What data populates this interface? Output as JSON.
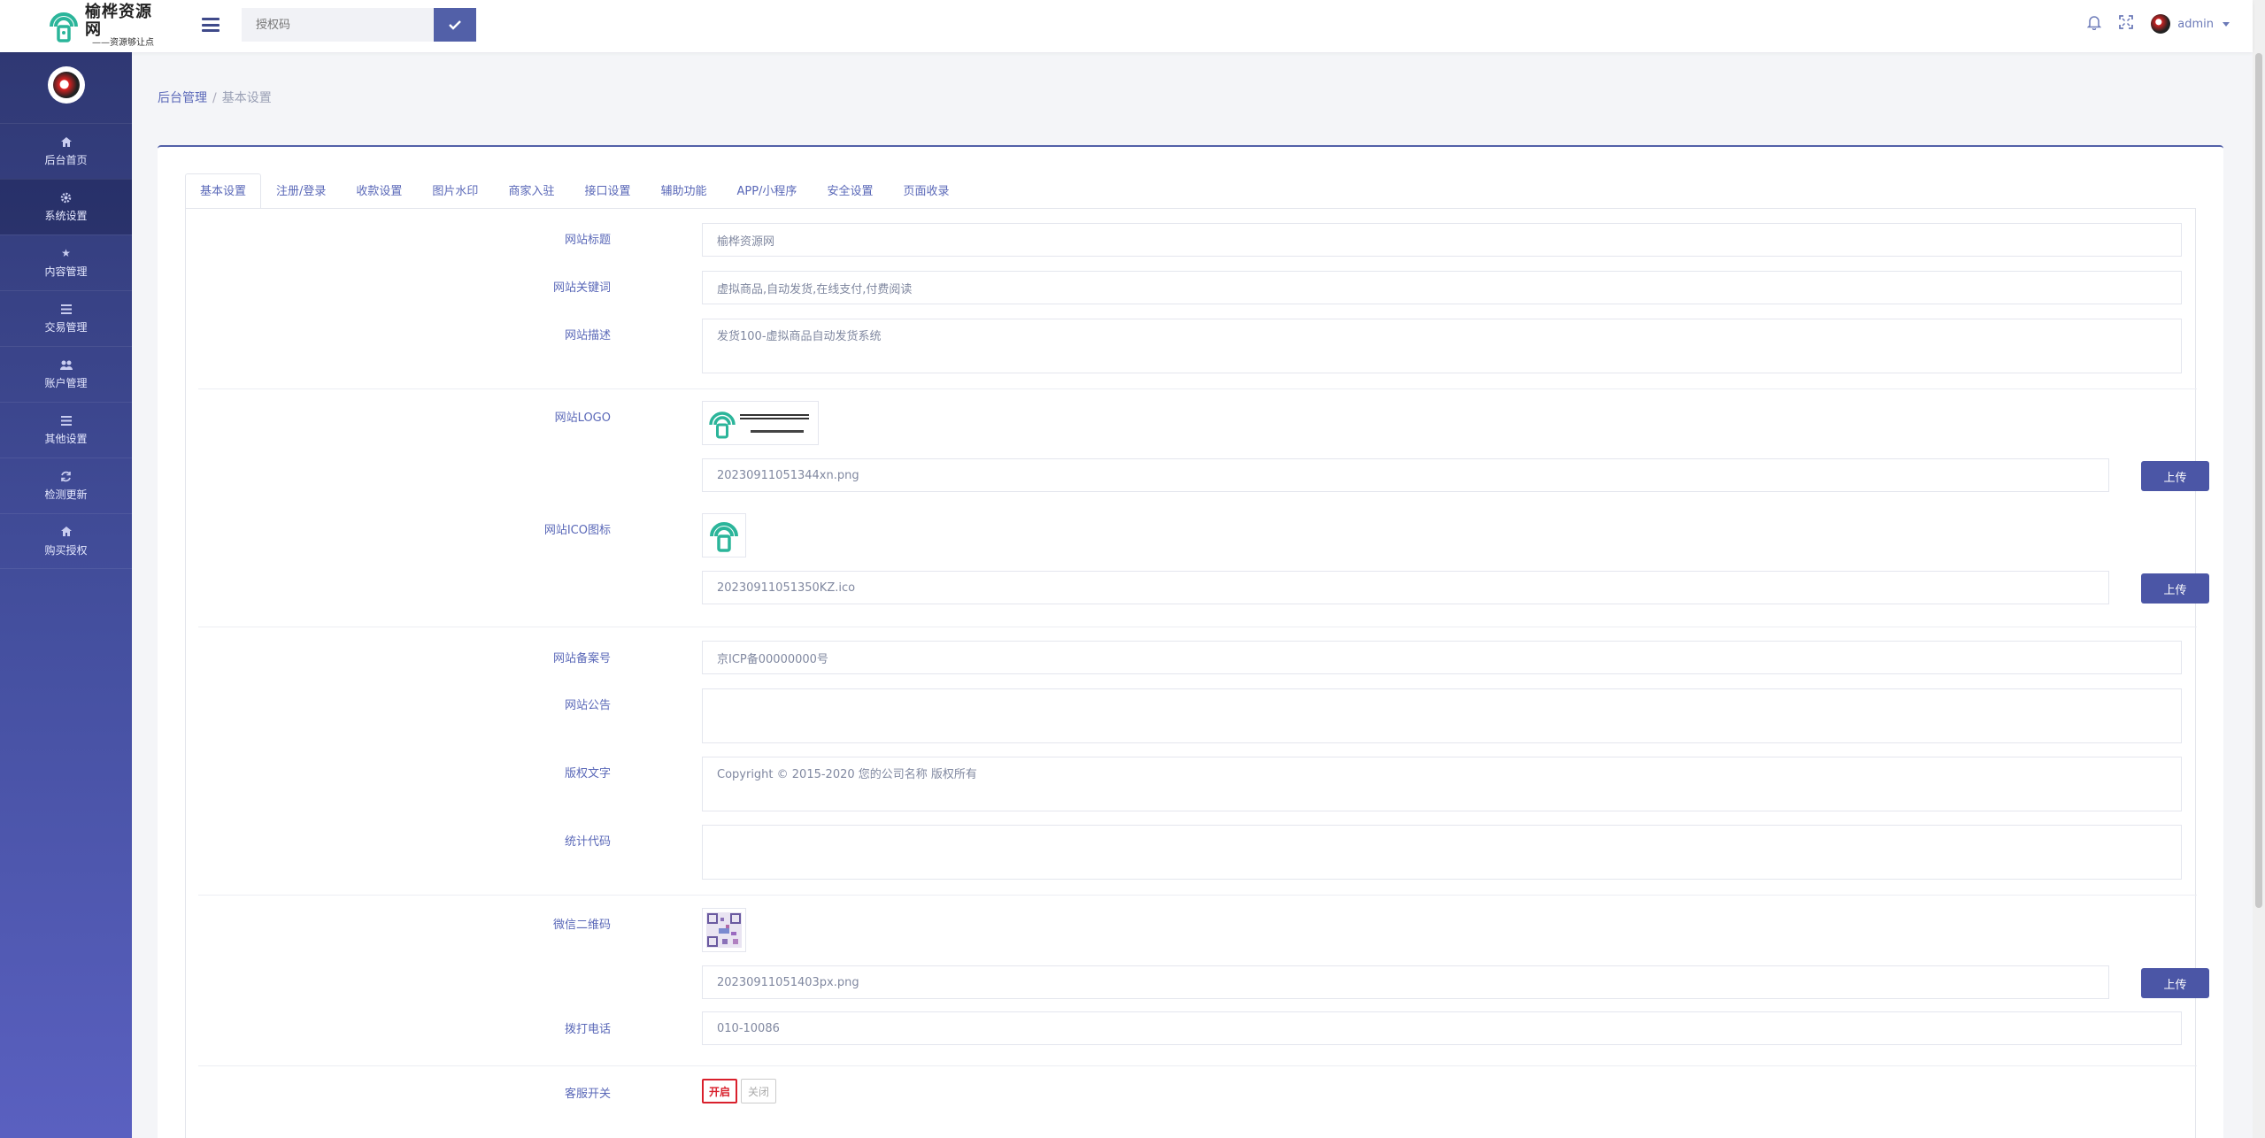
{
  "brand": {
    "name": "榆桦资源网",
    "slogan": "——资源够让点",
    "color": "#2bb59a"
  },
  "topbar": {
    "search_placeholder": "授权码",
    "user_name": "admin"
  },
  "sidebar": {
    "items": [
      {
        "label": "后台首页",
        "icon": "home-icon"
      },
      {
        "label": "系统设置",
        "icon": "gear-icon"
      },
      {
        "label": "内容管理",
        "icon": "star-icon"
      },
      {
        "label": "交易管理",
        "icon": "list-icon"
      },
      {
        "label": "账户管理",
        "icon": "users-icon"
      },
      {
        "label": "其他设置",
        "icon": "list-icon"
      },
      {
        "label": "检测更新",
        "icon": "refresh-icon"
      },
      {
        "label": "购买授权",
        "icon": "home-icon"
      }
    ]
  },
  "breadcrumb": {
    "home": "后台管理",
    "current": "基本设置"
  },
  "tabs": [
    "基本设置",
    "注册/登录",
    "收款设置",
    "图片水印",
    "商家入驻",
    "接口设置",
    "辅助功能",
    "APP/小程序",
    "安全设置",
    "页面收录"
  ],
  "form": {
    "site_title": {
      "label": "网站标题",
      "value": "榆桦资源网"
    },
    "site_keywords": {
      "label": "网站关键词",
      "value": "虚拟商品,自动发货,在线支付,付费阅读"
    },
    "site_desc": {
      "label": "网站描述",
      "value": "发货100-虚拟商品自动发货系统"
    },
    "site_logo": {
      "label": "网站LOGO",
      "value": "20230911051344xn.png"
    },
    "site_ico": {
      "label": "网站ICO图标",
      "value": "20230911051350KZ.ico"
    },
    "icp": {
      "label": "网站备案号",
      "value": "京ICP备00000000号"
    },
    "notice": {
      "label": "网站公告",
      "value": ""
    },
    "copyright": {
      "label": "版权文字",
      "value": "Copyright © 2015-2020 您的公司名称 版权所有"
    },
    "stats": {
      "label": "统计代码",
      "value": ""
    },
    "wechat_qr": {
      "label": "微信二维码",
      "value": "20230911051403px.png"
    },
    "phone": {
      "label": "拨打电话",
      "value": "010-10086"
    },
    "service": {
      "label": "客服开关",
      "on": "开启",
      "off": "关闭"
    },
    "upload_label": "上传"
  }
}
